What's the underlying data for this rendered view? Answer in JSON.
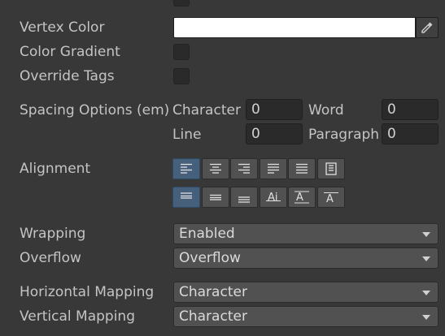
{
  "rows": {
    "vertex_color": "Vertex Color",
    "color_gradient": "Color Gradient",
    "override_tags": "Override Tags",
    "spacing_options": "Spacing Options (em)",
    "alignment": "Alignment",
    "wrapping": "Wrapping",
    "overflow": "Overflow",
    "horizontal_mapping": "Horizontal Mapping",
    "vertical_mapping": "Vertical Mapping"
  },
  "vertex_color_value": "#FFFFFF",
  "color_gradient_checked": false,
  "override_tags_checked": false,
  "spacing": {
    "character_label": "Character",
    "character_value": "0",
    "word_label": "Word",
    "word_value": "0",
    "line_label": "Line",
    "line_value": "0",
    "paragraph_label": "Paragraph",
    "paragraph_value": "0"
  },
  "alignment": {
    "horizontal_buttons": [
      "align-left-icon",
      "align-center-icon",
      "align-right-icon",
      "align-justify-icon",
      "align-flush-icon",
      "align-geometry-center-icon"
    ],
    "horizontal_selected": "align-left-icon",
    "vertical_buttons": [
      "align-top-icon",
      "align-middle-icon",
      "align-bottom-icon",
      "align-baseline-icon",
      "align-midline-icon",
      "align-capline-icon"
    ],
    "vertical_selected": "align-top-icon"
  },
  "wrapping_value": "Enabled",
  "overflow_value": "Overflow",
  "horizontal_mapping_value": "Character",
  "vertical_mapping_value": "Character",
  "colors": {
    "background": "#383838",
    "field": "#2a2a2a",
    "button": "#515151",
    "active_button": "#46607c",
    "text": "#c4c4c4"
  }
}
